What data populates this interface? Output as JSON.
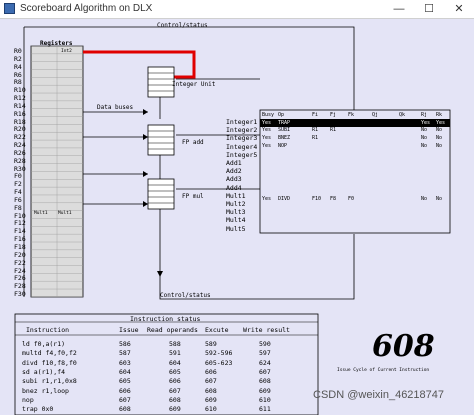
{
  "window": {
    "title": "Scoreboard Algorithm on DLX",
    "minimize_glyph": "—",
    "maximize_glyph": "☐",
    "close_glyph": "✕"
  },
  "labels": {
    "control_status_top": "Control/status",
    "control_status_bottom": "Control/status",
    "registers": "Registers",
    "data_buses": "Data buses",
    "integer_unit": "Integer Unit",
    "fp_add": "FP add",
    "fp_mul": "FP mul",
    "int2": "Int2",
    "mult1_a": "Mult1",
    "mult1_b": "Mult1",
    "instruction_status": "Instruction status",
    "issue_cycle_caption": "Issue Cycle of Current Instruction"
  },
  "registers": [
    "R0",
    "R2",
    "R4",
    "R6",
    "R8",
    "R10",
    "R12",
    "R14",
    "R16",
    "R18",
    "R20",
    "R22",
    "R24",
    "R26",
    "R28",
    "R30",
    "F0",
    "F2",
    "F4",
    "F6",
    "F8",
    "F10",
    "F12",
    "F14",
    "F16",
    "F18",
    "F20",
    "F22",
    "F24",
    "F26",
    "F28",
    "F30"
  ],
  "functional_units": [
    "Integer1",
    "Integer2",
    "Integer3",
    "Integer4",
    "Integer5",
    "Add1",
    "Add2",
    "Add3",
    "Add4",
    "Mult1",
    "Mult2",
    "Mult3",
    "Mult4",
    "Mult5"
  ],
  "fu_table": {
    "headers": [
      "Busy",
      "Op",
      "Fi",
      "Fj",
      "Fk",
      "Qj",
      "Qk",
      "Rj",
      "Rk"
    ],
    "rows": [
      {
        "busy": "Yes",
        "op": "TRAP",
        "fi": "",
        "fj": "",
        "fk": "",
        "qj": "",
        "qk": "",
        "rj": "Yes",
        "rk": "Yes"
      },
      {
        "busy": "Yes",
        "op": "SUBI",
        "fi": "R1",
        "fj": "R1",
        "fk": "",
        "qj": "",
        "qk": "",
        "rj": "No",
        "rk": "No"
      },
      {
        "busy": "Yes",
        "op": "BNEZ",
        "fi": "R1",
        "fj": "",
        "fk": "",
        "qj": "",
        "qk": "",
        "rj": "No",
        "rk": "No"
      },
      {
        "busy": "Yes",
        "op": "NOP",
        "fi": "",
        "fj": "",
        "fk": "",
        "qj": "",
        "qk": "",
        "rj": "No",
        "rk": "No"
      },
      {
        "busy": "Yes",
        "op": "DIVD",
        "fi": "F10",
        "fj": "F8",
        "fk": "F0",
        "qj": "",
        "qk": "",
        "rj": "No",
        "rk": "No"
      }
    ]
  },
  "instruction_table": {
    "headers": [
      "Instruction",
      "Issue",
      "Read operands",
      "Excute",
      "Write result"
    ],
    "rows": [
      {
        "instr": "ld f0,a(r1)",
        "issue": "586",
        "read": "588",
        "exec": "589",
        "write": "590"
      },
      {
        "instr": "multd f4,f0,f2",
        "issue": "587",
        "read": "591",
        "exec": "592-596",
        "write": "597"
      },
      {
        "instr": "divd f10,f8,f0",
        "issue": "603",
        "read": "604",
        "exec": "605-623",
        "write": "624"
      },
      {
        "instr": "sd a(r1),f4",
        "issue": "604",
        "read": "605",
        "exec": "606",
        "write": "607"
      },
      {
        "instr": "subi r1,r1,0x8",
        "issue": "605",
        "read": "606",
        "exec": "607",
        "write": "608"
      },
      {
        "instr": "bnez r1,loop",
        "issue": "606",
        "read": "607",
        "exec": "608",
        "write": "609"
      },
      {
        "instr": "nop",
        "issue": "607",
        "read": "608",
        "exec": "609",
        "write": "610"
      },
      {
        "instr": "trap 0x0",
        "issue": "608",
        "read": "609",
        "exec": "610",
        "write": "611"
      }
    ]
  },
  "current_cycle": "608",
  "watermark": "CSDN @weixin_46218747",
  "colors": {
    "background": "#e4e4f6",
    "highlight_path": "#e00000",
    "highlight_row": "#000000"
  }
}
